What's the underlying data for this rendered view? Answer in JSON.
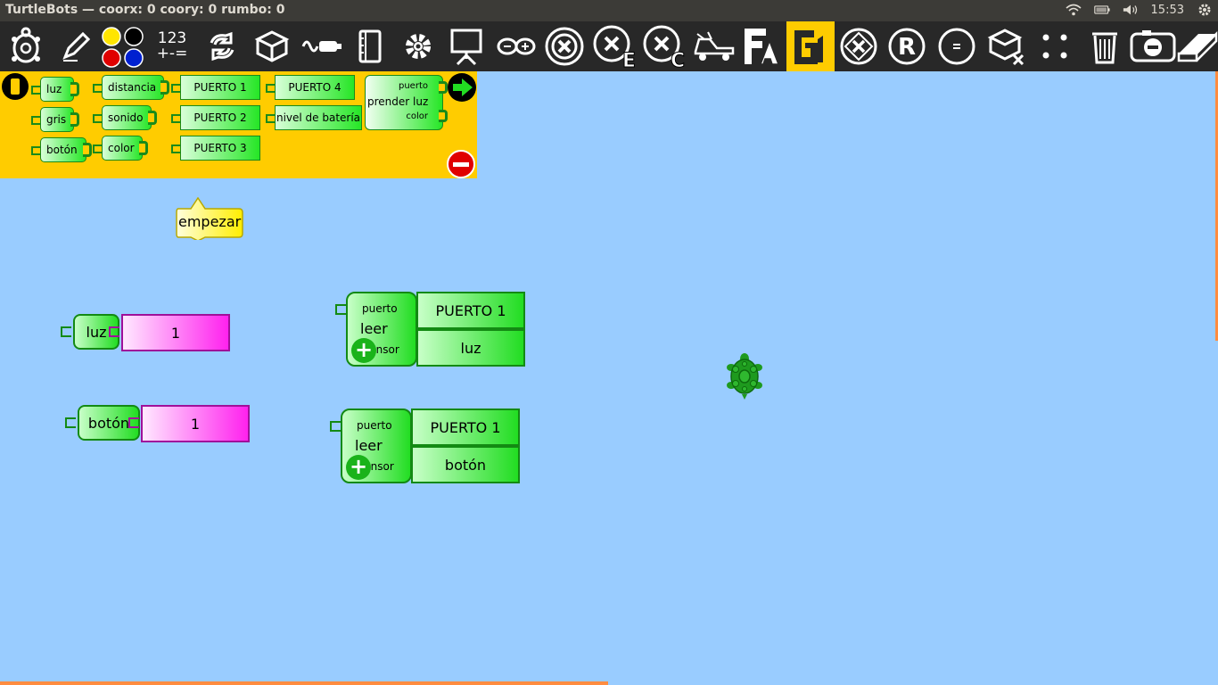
{
  "window": {
    "title": "TurtleBots — coorx: 0 coory: 0 rumbo: 0",
    "clock": "15:53"
  },
  "toolbar": {
    "numbers_top": "123",
    "numbers_bottom": "+-=",
    "items": [
      "turtle-palette-icon",
      "pen-palette-icon",
      "colors-palette-icon",
      "numbers-palette-icon",
      "flow-palette-icon",
      "blocks-palette-icon",
      "sensors-palette-icon",
      "media-palette-icon",
      "extras-palette-icon",
      "presentation-palette-icon",
      "arduino-palette-icon",
      "butia-palette-icon",
      "butia-e-palette-icon",
      "butia-c-palette-icon",
      "vehicle-palette-icon",
      "fa-palette-icon",
      "g1-palette-icon",
      "x-diamond-palette-icon",
      "r-palette-icon",
      "minus-palette-icon",
      "cubes-x-palette-icon",
      "dots-palette-icon",
      "trash-icon",
      "stop-icon",
      "eraser-icon"
    ],
    "active": "g1-palette-icon",
    "icon_color_yellow": "#ffe500",
    "icon_color_black": "#000000",
    "icon_color_red": "#e00000",
    "icon_color_blue": "#0020d0"
  },
  "palette": {
    "sensors_col1": [
      "luz",
      "gris",
      "botón"
    ],
    "sensors_col2": [
      "distancia",
      "sonido",
      "color"
    ],
    "ports_col1": [
      "PUERTO 1",
      "PUERTO 2",
      "PUERTO 3"
    ],
    "ports_col2": [
      "PUERTO 4",
      "nivel de batería"
    ],
    "prender": {
      "label": "prender luz",
      "arg1": "puerto",
      "arg2": "color"
    }
  },
  "canvas": {
    "start_label": "empezar",
    "luz_block": {
      "label": "luz",
      "value": "1"
    },
    "boton_block": {
      "label": "botón",
      "value": "1"
    },
    "leer1": {
      "top": "puerto",
      "main": "leer",
      "bottom": "sensor",
      "port": "PUERTO 1",
      "sensor": "luz"
    },
    "leer2": {
      "top": "puerto",
      "main": "leer",
      "bottom": "sensor",
      "port": "PUERTO 1",
      "sensor": "botón"
    }
  },
  "colors": {
    "canvas_bg": "#99ccff",
    "palette_bg": "#ffcc00",
    "block_green": "#22dd22",
    "block_pink": "#ff22ee",
    "turtle": "#1e9a1e"
  }
}
